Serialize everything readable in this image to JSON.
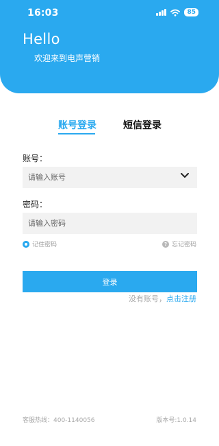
{
  "status_bar": {
    "time": "16:03",
    "battery": "85"
  },
  "header": {
    "greeting": "Hello",
    "subtitle": "欢迎来到电声营销"
  },
  "tabs": [
    {
      "label": "账号登录",
      "active": true
    },
    {
      "label": "短信登录",
      "active": false
    }
  ],
  "form": {
    "account_label": "账号：",
    "account_placeholder": "请输入账号",
    "password_label": "密码：",
    "password_placeholder": "请输入密码",
    "remember_label": "记住密码",
    "forgot_label": "忘记密码",
    "login_button": "登录"
  },
  "register": {
    "prompt": "没有账号，",
    "link": "点击注册"
  },
  "footer": {
    "hotline": "客服热线：400-1140056",
    "version": "版本号:1.0.14"
  },
  "colors": {
    "accent": "#2aa9ef",
    "field_bg": "#f2f2f2"
  },
  "icons": [
    "signal-icon",
    "wifi-icon",
    "battery-icon",
    "chevron-down-icon",
    "radio-checked-icon",
    "question-icon"
  ]
}
